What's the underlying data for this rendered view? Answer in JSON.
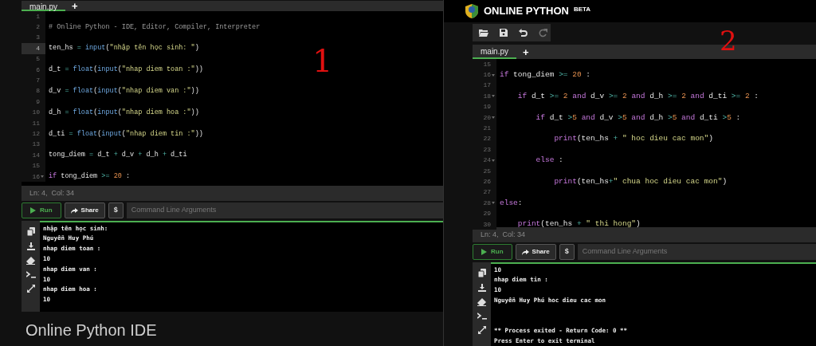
{
  "left_panel": {
    "tabs": [
      {
        "label": "main.py",
        "selected": true
      }
    ],
    "add_tab": "+",
    "editor": {
      "lines": [
        {
          "number": "1",
          "fold": false,
          "active": false
        },
        {
          "number": "2",
          "fold": false,
          "active": false,
          "tokens": [
            {
              "kind": "comment",
              "text": "# Online Python - IDE, Editor, Compiler, Interpreter"
            }
          ]
        },
        {
          "number": "3",
          "fold": false,
          "active": false
        },
        {
          "number": "4",
          "fold": false,
          "active": true,
          "tokens": [
            {
              "kind": "plain",
              "text": "ten_hs "
            },
            {
              "kind": "operator",
              "text": "= "
            },
            {
              "kind": "function",
              "text": "input"
            },
            {
              "kind": "plain",
              "text": "("
            },
            {
              "kind": "string",
              "text": "\"nhập tên học sinh: \""
            },
            {
              "kind": "plain",
              "text": ")"
            }
          ]
        },
        {
          "number": "5",
          "fold": false,
          "active": false
        },
        {
          "number": "6",
          "fold": false,
          "active": false,
          "tokens": [
            {
              "kind": "plain",
              "text": "d_t "
            },
            {
              "kind": "operator",
              "text": "= "
            },
            {
              "kind": "function",
              "text": "float"
            },
            {
              "kind": "plain",
              "text": "("
            },
            {
              "kind": "function",
              "text": "input"
            },
            {
              "kind": "plain",
              "text": "("
            },
            {
              "kind": "string",
              "text": "\"nhap diem toan :\""
            },
            {
              "kind": "plain",
              "text": "))"
            }
          ]
        },
        {
          "number": "7",
          "fold": false,
          "active": false
        },
        {
          "number": "8",
          "fold": false,
          "active": false,
          "tokens": [
            {
              "kind": "plain",
              "text": "d_v "
            },
            {
              "kind": "operator",
              "text": "= "
            },
            {
              "kind": "function",
              "text": "float"
            },
            {
              "kind": "plain",
              "text": "("
            },
            {
              "kind": "function",
              "text": "input"
            },
            {
              "kind": "plain",
              "text": "("
            },
            {
              "kind": "string",
              "text": "\"nhap diem van :\""
            },
            {
              "kind": "plain",
              "text": "))"
            }
          ]
        },
        {
          "number": "9",
          "fold": false,
          "active": false
        },
        {
          "number": "10",
          "fold": false,
          "active": false,
          "tokens": [
            {
              "kind": "plain",
              "text": "d_h "
            },
            {
              "kind": "operator",
              "text": "= "
            },
            {
              "kind": "function",
              "text": "float"
            },
            {
              "kind": "plain",
              "text": "("
            },
            {
              "kind": "function",
              "text": "input"
            },
            {
              "kind": "plain",
              "text": "("
            },
            {
              "kind": "string",
              "text": "\"nhap diem hoa :\""
            },
            {
              "kind": "plain",
              "text": "))"
            }
          ]
        },
        {
          "number": "11",
          "fold": false,
          "active": false
        },
        {
          "number": "12",
          "fold": false,
          "active": false,
          "tokens": [
            {
              "kind": "plain",
              "text": "d_ti "
            },
            {
              "kind": "operator",
              "text": "= "
            },
            {
              "kind": "function",
              "text": "float"
            },
            {
              "kind": "plain",
              "text": "("
            },
            {
              "kind": "function",
              "text": "input"
            },
            {
              "kind": "plain",
              "text": "("
            },
            {
              "kind": "string",
              "text": "\"nhap diem tin :\""
            },
            {
              "kind": "plain",
              "text": "))"
            }
          ]
        },
        {
          "number": "13",
          "fold": false,
          "active": false
        },
        {
          "number": "14",
          "fold": false,
          "active": false,
          "tokens": [
            {
              "kind": "plain",
              "text": "tong_diem "
            },
            {
              "kind": "operator",
              "text": "="
            },
            {
              "kind": "plain",
              "text": " d_t "
            },
            {
              "kind": "operator",
              "text": "+"
            },
            {
              "kind": "plain",
              "text": " d_v "
            },
            {
              "kind": "operator",
              "text": "+"
            },
            {
              "kind": "plain",
              "text": " d_h "
            },
            {
              "kind": "operator",
              "text": "+"
            },
            {
              "kind": "plain",
              "text": " d_ti"
            }
          ]
        },
        {
          "number": "15",
          "fold": false,
          "active": false
        },
        {
          "number": "16",
          "fold": true,
          "active": false,
          "tokens": [
            {
              "kind": "keyword",
              "text": "if"
            },
            {
              "kind": "plain",
              "text": " tong_diem "
            },
            {
              "kind": "operator",
              "text": ">= "
            },
            {
              "kind": "number",
              "text": "20"
            },
            {
              "kind": "plain",
              "text": " :"
            }
          ]
        }
      ]
    },
    "status": "Ln: 4,  Col: 34",
    "run_bar": {
      "run": "Run",
      "share": "Share",
      "dollar": "$",
      "args_placeholder": "Command Line Arguments"
    },
    "terminal": {
      "lines": [
        {
          "text": "nhập tên học sinh:",
          "spaced": false
        },
        {
          "text": "Nguyễn Huy Phú",
          "spaced": false
        },
        {
          "text": "nhap diem toan :",
          "spaced": false
        },
        {
          "text": "10",
          "spaced": false
        },
        {
          "text": "nhap diem van :",
          "spaced": false
        },
        {
          "text": "10",
          "spaced": false
        },
        {
          "text": "nhap diem hoa :",
          "spaced": false
        },
        {
          "text": "10",
          "spaced": false
        }
      ]
    },
    "footer_title": "Online Python IDE",
    "annotation": "1"
  },
  "right_panel": {
    "header": {
      "title": "ONLINE PYTHON",
      "badge": "BETA"
    },
    "toolbar": [
      {
        "kind": "open",
        "disabled": false
      },
      {
        "kind": "save",
        "disabled": false
      },
      {
        "kind": "undo",
        "disabled": false
      },
      {
        "kind": "redo",
        "disabled": true
      }
    ],
    "tabs": [
      {
        "label": "main.py",
        "selected": true
      }
    ],
    "add_tab": "+",
    "editor": {
      "lines": [
        {
          "number": "15",
          "fold": false,
          "active": false
        },
        {
          "number": "16",
          "fold": true,
          "active": false,
          "tokens": [
            {
              "kind": "keyword",
              "text": "if"
            },
            {
              "kind": "plain",
              "text": " tong_diem "
            },
            {
              "kind": "operator",
              "text": ">= "
            },
            {
              "kind": "number",
              "text": "20"
            },
            {
              "kind": "plain",
              "text": " :"
            }
          ]
        },
        {
          "number": "17",
          "fold": false,
          "active": false
        },
        {
          "number": "18",
          "fold": true,
          "active": false,
          "tokens": [
            {
              "kind": "keyword",
              "text": "    if"
            },
            {
              "kind": "plain",
              "text": " d_t "
            },
            {
              "kind": "operator",
              "text": ">= "
            },
            {
              "kind": "number",
              "text": "2"
            },
            {
              "kind": "keyword",
              "text": " and"
            },
            {
              "kind": "plain",
              "text": " d_v "
            },
            {
              "kind": "operator",
              "text": ">= "
            },
            {
              "kind": "number",
              "text": "2"
            },
            {
              "kind": "keyword",
              "text": " and"
            },
            {
              "kind": "plain",
              "text": " d_h "
            },
            {
              "kind": "operator",
              "text": ">= "
            },
            {
              "kind": "number",
              "text": "2"
            },
            {
              "kind": "keyword",
              "text": " and"
            },
            {
              "kind": "plain",
              "text": " d_ti "
            },
            {
              "kind": "operator",
              "text": ">= "
            },
            {
              "kind": "number",
              "text": "2"
            },
            {
              "kind": "plain",
              "text": " :"
            }
          ]
        },
        {
          "number": "19",
          "fold": false,
          "active": false
        },
        {
          "number": "20",
          "fold": true,
          "active": false,
          "tokens": [
            {
              "kind": "keyword",
              "text": "        if"
            },
            {
              "kind": "plain",
              "text": " d_t "
            },
            {
              "kind": "operator",
              "text": ">"
            },
            {
              "kind": "number",
              "text": "5"
            },
            {
              "kind": "keyword",
              "text": " and"
            },
            {
              "kind": "plain",
              "text": " d_v "
            },
            {
              "kind": "operator",
              "text": ">"
            },
            {
              "kind": "number",
              "text": "5"
            },
            {
              "kind": "keyword",
              "text": " and"
            },
            {
              "kind": "plain",
              "text": " d_h "
            },
            {
              "kind": "operator",
              "text": ">"
            },
            {
              "kind": "number",
              "text": "5"
            },
            {
              "kind": "keyword",
              "text": " and"
            },
            {
              "kind": "plain",
              "text": " d_ti "
            },
            {
              "kind": "operator",
              "text": ">"
            },
            {
              "kind": "number",
              "text": "5"
            },
            {
              "kind": "plain",
              "text": " :"
            }
          ]
        },
        {
          "number": "21",
          "fold": false,
          "active": false
        },
        {
          "number": "22",
          "fold": false,
          "active": false,
          "tokens": [
            {
              "kind": "keyword",
              "text": "            print"
            },
            {
              "kind": "plain",
              "text": "(ten_hs "
            },
            {
              "kind": "operator",
              "text": "+ "
            },
            {
              "kind": "string",
              "text": "\" hoc dieu cac mon\""
            },
            {
              "kind": "plain",
              "text": ")"
            }
          ]
        },
        {
          "number": "23",
          "fold": false,
          "active": false
        },
        {
          "number": "24",
          "fold": true,
          "active": false,
          "tokens": [
            {
              "kind": "keyword",
              "text": "        else"
            },
            {
              "kind": "plain",
              "text": " :"
            }
          ]
        },
        {
          "number": "25",
          "fold": false,
          "active": false
        },
        {
          "number": "26",
          "fold": false,
          "active": false,
          "tokens": [
            {
              "kind": "keyword",
              "text": "            print"
            },
            {
              "kind": "plain",
              "text": "(ten_hs"
            },
            {
              "kind": "operator",
              "text": "+"
            },
            {
              "kind": "string",
              "text": "\" chua hoc dieu cac mon\""
            },
            {
              "kind": "plain",
              "text": ")"
            }
          ]
        },
        {
          "number": "27",
          "fold": false,
          "active": false
        },
        {
          "number": "28",
          "fold": true,
          "active": false,
          "tokens": [
            {
              "kind": "keyword",
              "text": "else"
            },
            {
              "kind": "plain",
              "text": ":"
            }
          ]
        },
        {
          "number": "29",
          "fold": false,
          "active": false
        },
        {
          "number": "30",
          "fold": false,
          "active": false,
          "tokens": [
            {
              "kind": "keyword",
              "text": "    print"
            },
            {
              "kind": "plain",
              "text": "(ten_hs "
            },
            {
              "kind": "operator",
              "text": "+ "
            },
            {
              "kind": "string",
              "text": "\" thi hong\""
            },
            {
              "kind": "plain",
              "text": ")"
            }
          ]
        }
      ]
    },
    "status": "Ln: 4,  Col: 34",
    "run_bar": {
      "run": "Run",
      "share": "Share",
      "dollar": "$",
      "args_placeholder": "Command Line Arguments"
    },
    "terminal": {
      "lines": [
        {
          "text": "10",
          "spaced": false
        },
        {
          "text": "nhap diem tin :",
          "spaced": false
        },
        {
          "text": "10",
          "spaced": false
        },
        {
          "text": "Nguyễn Huy Phú hoc dieu cac mon",
          "spaced": false
        },
        {
          "text": "** Process exited - Return Code: 0 **",
          "spaced": true
        },
        {
          "text": "Press Enter to exit terminal",
          "spaced": false
        }
      ]
    },
    "annotation": "2"
  }
}
